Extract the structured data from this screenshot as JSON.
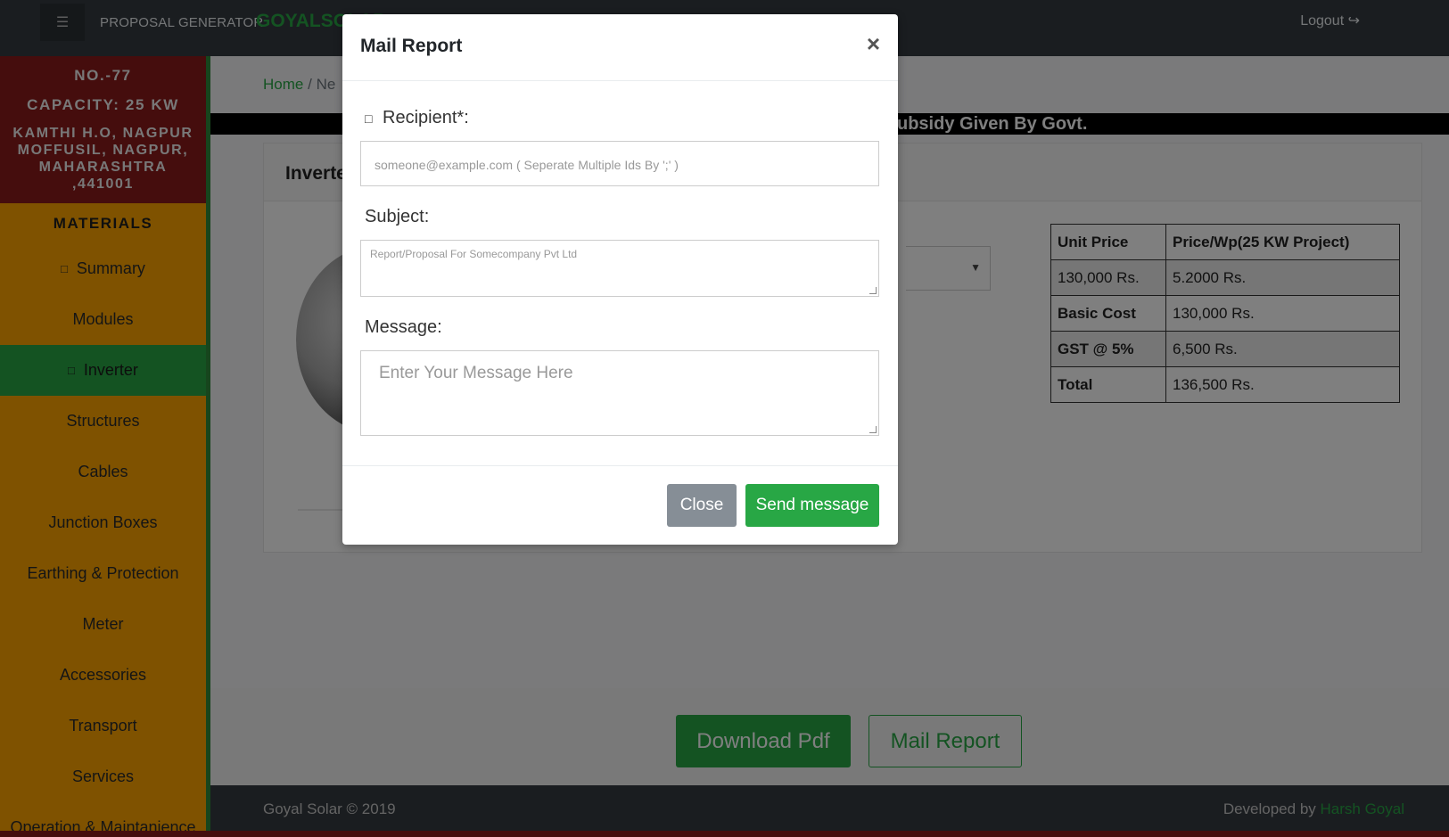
{
  "navbar": {
    "menu_icon": "hamburger-icon",
    "brand": "PROPOSAL GENERATOR",
    "brand_accent": "GOYALSOLAR",
    "logout": "Logout",
    "logout_icon": "sign-out-icon"
  },
  "sidebar": {
    "project_no": "NO.-77",
    "capacity": "CAPACITY: 25 KW",
    "address_line1": "KAMTHI H.O, NAGPUR",
    "address_line2": "MOFFUSIL, NAGPUR,",
    "address_line3": "MAHARASHTRA",
    "address_line4": ",441001",
    "materials_title": "MATERIALS",
    "items": [
      {
        "label": "Summary",
        "icon": "summary-icon"
      },
      {
        "label": "Modules"
      },
      {
        "label": "Inverter",
        "icon": "inverter-icon",
        "active": true
      },
      {
        "label": "Structures"
      },
      {
        "label": "Cables"
      },
      {
        "label": "Junction Boxes"
      },
      {
        "label": "Earthing & Protection"
      },
      {
        "label": "Meter"
      },
      {
        "label": "Accessories"
      },
      {
        "label": "Transport"
      },
      {
        "label": "Services"
      },
      {
        "label": "Operation & Maintanience"
      }
    ]
  },
  "breadcrumb": {
    "home": "Home",
    "separator": "/",
    "current": "Ne"
  },
  "banner": {
    "text": "ubsidy Given By Govt."
  },
  "card": {
    "title": "Inverte"
  },
  "price_table": {
    "headers": [
      "Unit Price",
      "Price/Wp(25 KW Project)"
    ],
    "rows": [
      [
        "130,000 Rs.",
        "5.2000 Rs."
      ],
      [
        "Basic Cost",
        "130,000 Rs."
      ],
      [
        "GST @ 5%",
        "6,500 Rs."
      ],
      [
        "Total",
        "136,500 Rs."
      ]
    ]
  },
  "actions": {
    "download_pdf": "Download Pdf",
    "mail_report": "Mail Report"
  },
  "footer": {
    "copyright": "Goyal Solar © 2019",
    "developed_by": "Developed by",
    "developer": "Harsh Goyal"
  },
  "modal": {
    "title": "Mail Report",
    "close_symbol": "×",
    "recipient_label": "Recipient*:",
    "recipient_icon": "envelope-icon",
    "recipient_placeholder": "someone@example.com ( Seperate Multiple Ids By ';' )",
    "subject_label": "Subject:",
    "subject_placeholder": "Report/Proposal For Somecompany Pvt Ltd",
    "message_label": "Message:",
    "message_placeholder": "Enter Your Message Here",
    "close_button": "Close",
    "send_button": "Send message"
  },
  "colors": {
    "accent": "#28a745",
    "sidebar_bg": "#ffa500",
    "address_bg": "#8b1a1a",
    "navbar_bg": "#343a40"
  }
}
